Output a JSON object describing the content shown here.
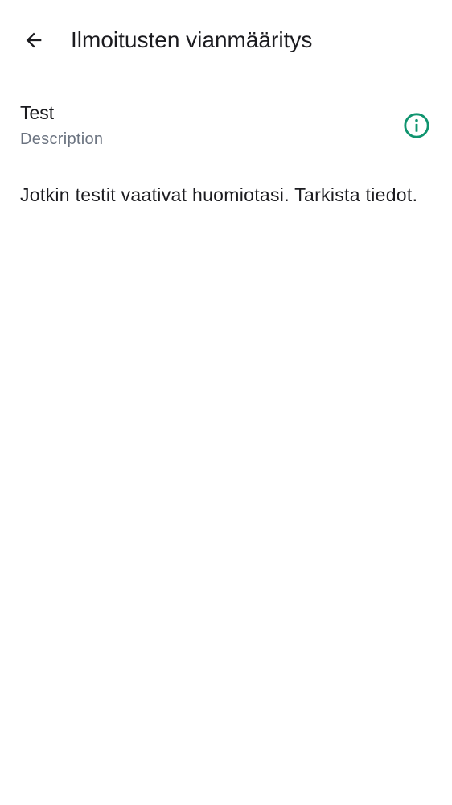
{
  "header": {
    "back_icon": "arrow-back-icon",
    "title": "Ilmoitusten vianmääritys"
  },
  "test_item": {
    "title": "Test",
    "description": "Description",
    "info_icon": "info-icon",
    "info_icon_color": "#10946f"
  },
  "notice": {
    "text": "Jotkin testit vaativat huomiotasi. Tarkista tiedot."
  },
  "colors": {
    "background": "#ffffff",
    "primary_text": "#1b1b1f",
    "secondary_text": "#6b7380",
    "accent": "#10946f"
  }
}
